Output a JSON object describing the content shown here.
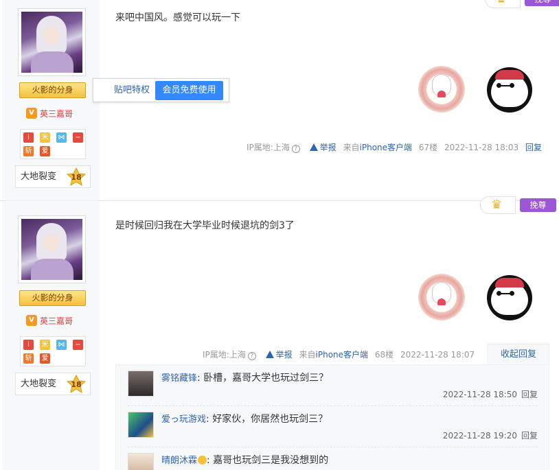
{
  "posts": [
    {
      "user": {
        "badge": "火影的分身",
        "vip_name": "英三嘉哥",
        "level_name": "大地裂变",
        "level": "18"
      },
      "content": "来吧中国风。感觉可以玩一下",
      "popup": {
        "label": "贴吧特权",
        "button": "会员免费使用"
      },
      "meta": {
        "ip": "IP属地:上海",
        "report": "举报",
        "client": "来自iPhone客户端",
        "floor": "67楼",
        "time": "2022-11-28 18:03",
        "reply": "回复"
      }
    },
    {
      "user": {
        "badge": "火影的分身",
        "vip_name": "英三嘉哥",
        "level_name": "大地裂变",
        "level": "18"
      },
      "content": "是时候回归我在大学毕业时候退坑的剑3了",
      "meta": {
        "ip": "IP属地:上海",
        "report": "举报",
        "client": "来自iPhone客户端",
        "floor": "68楼",
        "time": "2022-11-28 18:07",
        "collapse": "收起回复"
      },
      "tag_button": "挽尊",
      "replies": [
        {
          "name": "雾铭藏锋",
          "text": "卧槽，嘉哥大学也玩过剑三？",
          "time": "2022-11-28 18:50",
          "reply": "回复"
        },
        {
          "name": "爱っ玩游戏",
          "text": "好家伙，你居然也玩剑三？",
          "time": "2022-11-28 19:20",
          "reply": "回复"
        },
        {
          "name": "晴朗沐霖",
          "text": "嘉哥也玩剑三是我没想到的",
          "time": "",
          "reply": ""
        }
      ]
    }
  ],
  "top_tag_button": "挽尊",
  "colors": {
    "link": "#2d64b3",
    "vip_red": "#e0393e",
    "button_blue": "#3388ff",
    "tag_purple": "#9b57d6"
  }
}
